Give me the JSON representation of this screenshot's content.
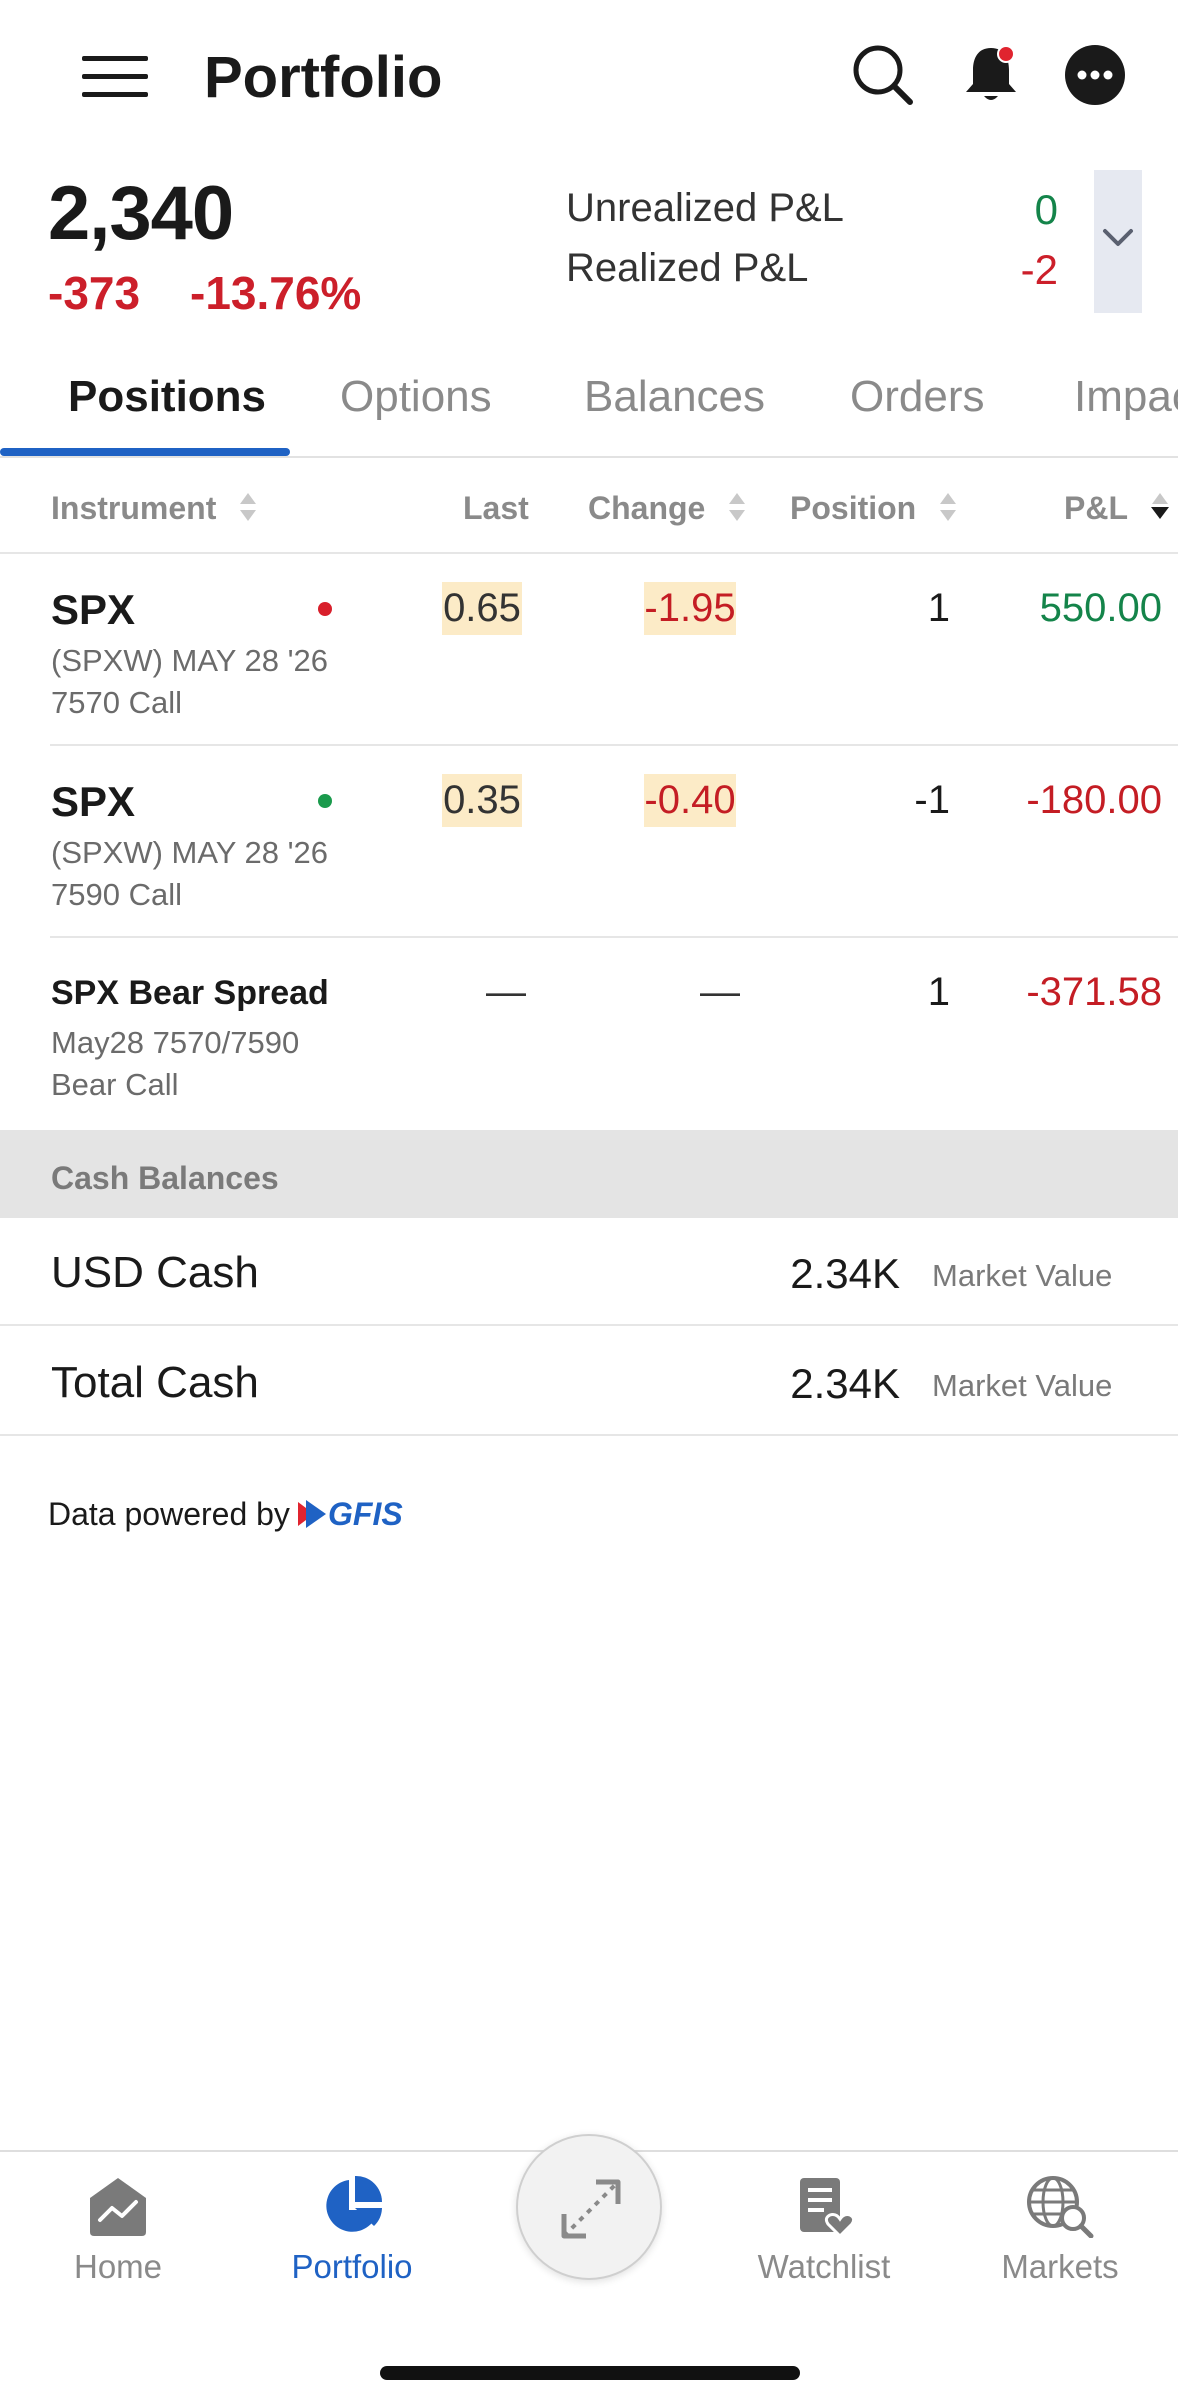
{
  "header": {
    "title": "Portfolio",
    "icons": [
      "hamburger-icon",
      "search-icon",
      "bell-icon",
      "more-icon"
    ],
    "notification_dot_color": "#e0242f"
  },
  "summary": {
    "total_value": "2,340",
    "change": "-373",
    "change_pct": "-13.76%",
    "unrealized_label": "Unrealized P&L",
    "unrealized_value": "0",
    "realized_label": "Realized P&L",
    "realized_value": "-2"
  },
  "tabs": [
    {
      "label": "Positions",
      "active": true
    },
    {
      "label": "Options",
      "active": false
    },
    {
      "label": "Balances",
      "active": false
    },
    {
      "label": "Orders",
      "active": false
    },
    {
      "label": "Impac",
      "active": false
    }
  ],
  "table": {
    "columns": [
      "Instrument",
      "Last",
      "Change",
      "Position",
      "P&L"
    ],
    "rows": [
      {
        "symbol": "SPX",
        "detail_line1": "(SPXW) MAY 28 '26",
        "detail_line2": "7570 Call",
        "dot_color": "#d81f2b",
        "last": "0.65",
        "change": "-1.95",
        "position": "1",
        "pl": "550.00",
        "pl_color": "#14844a"
      },
      {
        "symbol": "SPX",
        "detail_line1": "(SPXW) MAY 28 '26",
        "detail_line2": "7590 Call",
        "dot_color": "#1a9a4c",
        "last": "0.35",
        "change": "-0.40",
        "position": "-1",
        "pl": "-180.00",
        "pl_color": "#c41d24"
      },
      {
        "symbol": "SPX Bear Spread",
        "detail_line1": "May28 7570/7590",
        "detail_line2": "Bear Call",
        "last": "—",
        "change": "—",
        "position": "1",
        "pl": "-371.58",
        "pl_color": "#c41d24"
      }
    ]
  },
  "cash": {
    "header": "Cash Balances",
    "rows": [
      {
        "label": "USD Cash",
        "value": "2.34K",
        "sub": "Market Value"
      },
      {
        "label": "Total Cash",
        "value": "2.34K",
        "sub": "Market Value"
      }
    ]
  },
  "footer": {
    "powered_by": "Data powered by",
    "logo_text": "GFIS"
  },
  "bottom_nav": [
    {
      "label": "Home",
      "icon": "home-chart-icon",
      "active": false
    },
    {
      "label": "Portfolio",
      "icon": "pie-chart-icon",
      "active": true
    },
    {
      "label": "Watchlist",
      "icon": "watchlist-icon",
      "active": false
    },
    {
      "label": "Markets",
      "icon": "globe-search-icon",
      "active": false
    }
  ],
  "colors": {
    "accent": "#1f62c4",
    "negative": "#c41d24",
    "positive": "#14844a",
    "highlight": "#fcebc7"
  }
}
